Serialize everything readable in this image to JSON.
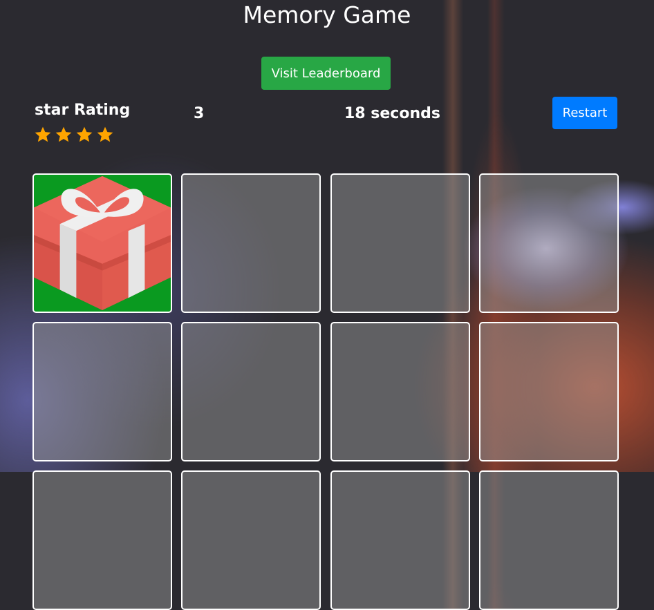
{
  "header": {
    "title": "Memory Game",
    "leaderboard_label": "Visit Leaderboard",
    "restart_label": "Restart"
  },
  "stats": {
    "rating_label": "star Rating",
    "stars": 4,
    "star_color": "#ffa500",
    "moves": "3",
    "timer": "18 seconds"
  },
  "colors": {
    "leaderboard": "#28a745",
    "restart": "#007bff",
    "open_card_bg": "#0a9a20"
  },
  "cards": [
    {
      "state": "open",
      "icon": "gift-icon"
    },
    {
      "state": "hidden"
    },
    {
      "state": "hidden"
    },
    {
      "state": "hidden"
    },
    {
      "state": "hidden"
    },
    {
      "state": "hidden"
    },
    {
      "state": "hidden"
    },
    {
      "state": "hidden"
    },
    {
      "state": "hidden"
    },
    {
      "state": "hidden"
    },
    {
      "state": "hidden"
    },
    {
      "state": "hidden"
    }
  ]
}
